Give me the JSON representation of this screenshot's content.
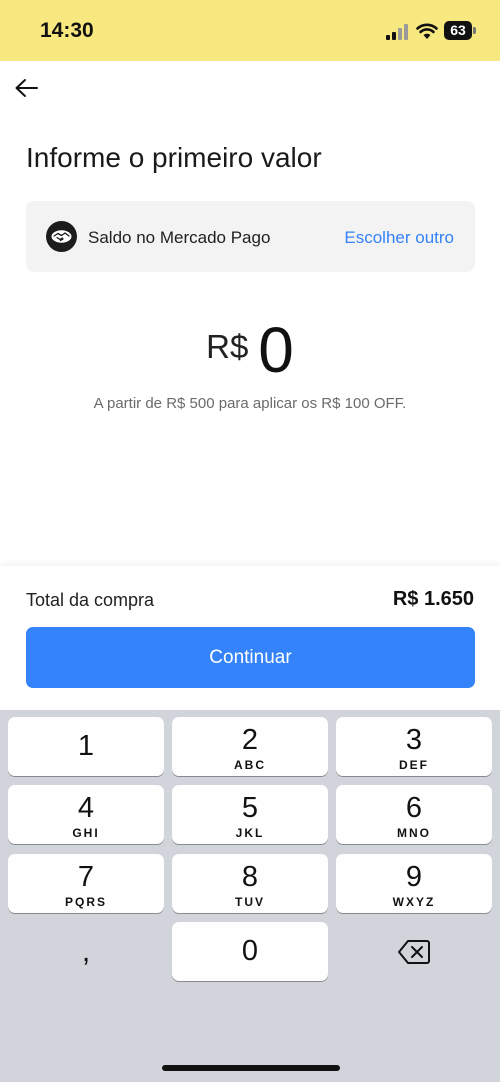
{
  "status_bar": {
    "time": "14:30",
    "battery": "63",
    "background": "#f7e87f"
  },
  "header": {
    "back_icon": "arrow-left-icon",
    "title": "Informe o primeiro valor"
  },
  "payment_method": {
    "icon": "mercado-pago-handshake-icon",
    "label": "Saldo no Mercado Pago",
    "action": "Escolher outro"
  },
  "amount": {
    "currency": "R$",
    "value": "0",
    "hint": "A partir de R$ 500 para aplicar os R$ 100 OFF."
  },
  "footer": {
    "total_label": "Total da compra",
    "total_value": "R$ 1.650",
    "continue_label": "Continuar"
  },
  "keyboard": {
    "keys": [
      {
        "digit": "1",
        "letters": ""
      },
      {
        "digit": "2",
        "letters": "ABC"
      },
      {
        "digit": "3",
        "letters": "DEF"
      },
      {
        "digit": "4",
        "letters": "GHI"
      },
      {
        "digit": "5",
        "letters": "JKL"
      },
      {
        "digit": "6",
        "letters": "MNO"
      },
      {
        "digit": "7",
        "letters": "PQRS"
      },
      {
        "digit": "8",
        "letters": "TUV"
      },
      {
        "digit": "9",
        "letters": "WXYZ"
      },
      {
        "digit": "0",
        "letters": ""
      }
    ],
    "comma": ",",
    "delete_icon": "backspace-icon"
  },
  "colors": {
    "accent": "#3483fa",
    "keyboard_bg": "#d2d4db"
  }
}
